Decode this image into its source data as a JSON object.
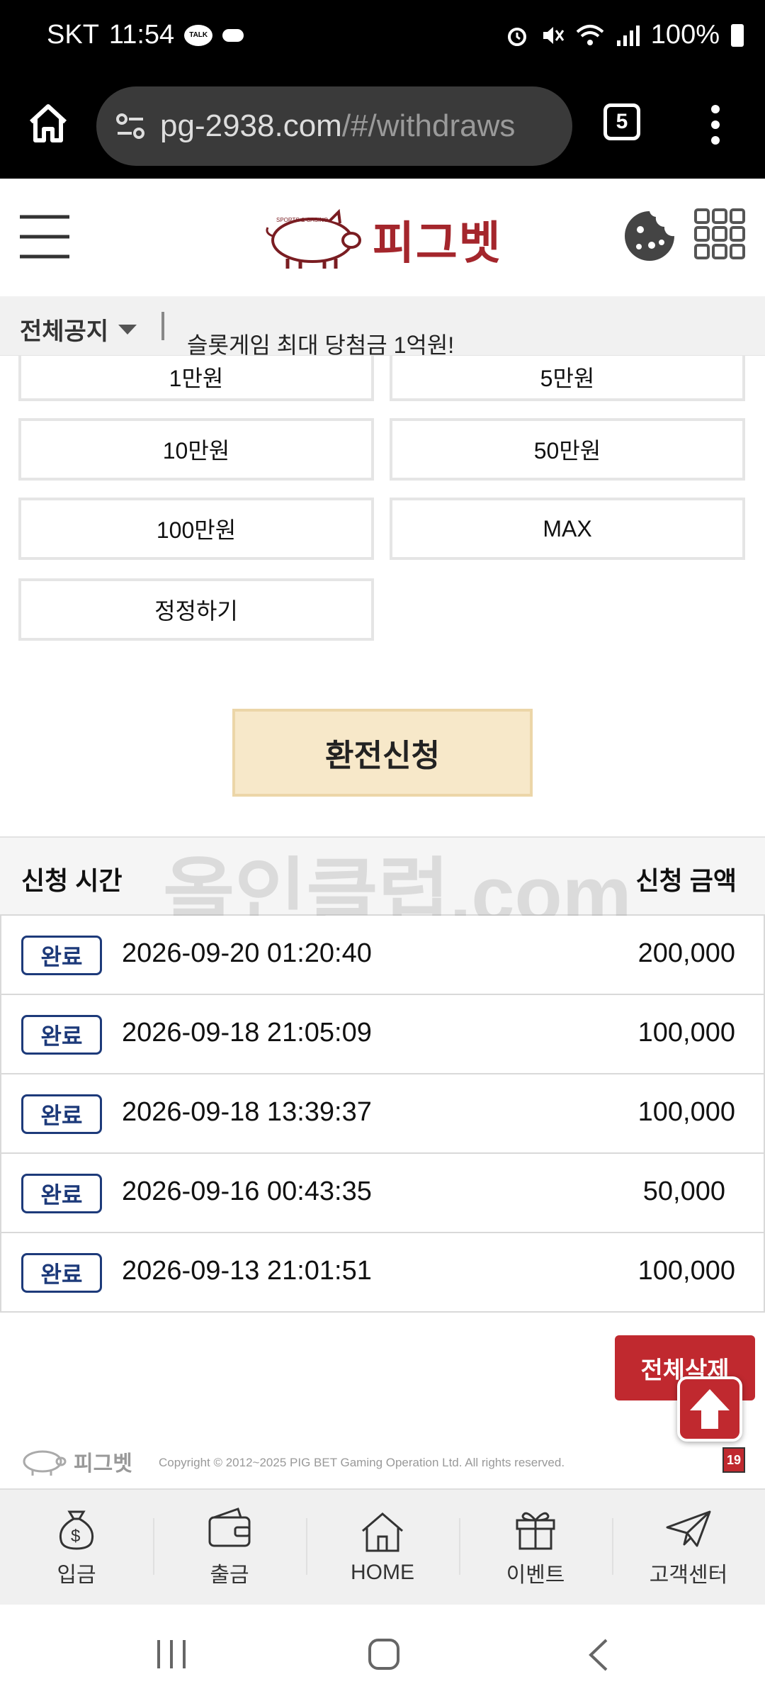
{
  "status_bar": {
    "carrier": "SKT",
    "time": "11:54",
    "talk_badge": "TALK",
    "battery": "100%"
  },
  "browser": {
    "url_domain": "pg-2938.com",
    "url_path": "/#/withdraws",
    "tab_count": "5"
  },
  "header": {
    "logo_text": "피그벳",
    "logo_small_text": "SPORTS & CASINO"
  },
  "notice": {
    "label": "전체공지",
    "text": "슬롯게임 최대 당첨금 1억원!"
  },
  "amount_buttons": [
    "1만원",
    "5만원",
    "10만원",
    "50만원",
    "100만원",
    "MAX",
    "정정하기"
  ],
  "submit_label": "환전신청",
  "watermark": "올인클럽.com",
  "history": {
    "col_time": "신청 시간",
    "col_amount": "신청 금액",
    "rows": [
      {
        "status": "완료",
        "time": "2026-09-20 01:20:40",
        "amount": "200,000"
      },
      {
        "status": "완료",
        "time": "2026-09-18 21:05:09",
        "amount": "100,000"
      },
      {
        "status": "완료",
        "time": "2026-09-18 13:39:37",
        "amount": "100,000"
      },
      {
        "status": "완료",
        "time": "2026-09-16 00:43:35",
        "amount": "50,000"
      },
      {
        "status": "완료",
        "time": "2026-09-13 21:01:51",
        "amount": "100,000"
      }
    ]
  },
  "delete_all_label": "전체삭제",
  "footer": {
    "logo_text": "피그벳",
    "copyright": "Copyright © 2012~2025 PIG BET Gaming Operation Ltd. All rights reserved.",
    "age_badge": "19"
  },
  "bottom_nav": [
    {
      "label": "입금",
      "icon": "money-bag-icon"
    },
    {
      "label": "출금",
      "icon": "wallet-icon"
    },
    {
      "label": "HOME",
      "icon": "house-icon"
    },
    {
      "label": "이벤트",
      "icon": "gift-icon"
    },
    {
      "label": "고객센터",
      "icon": "paper-plane-icon"
    }
  ],
  "colors": {
    "brand_red": "#c0292f",
    "badge_blue": "#1d3a7a",
    "submit_bg": "#f7e8c9"
  }
}
